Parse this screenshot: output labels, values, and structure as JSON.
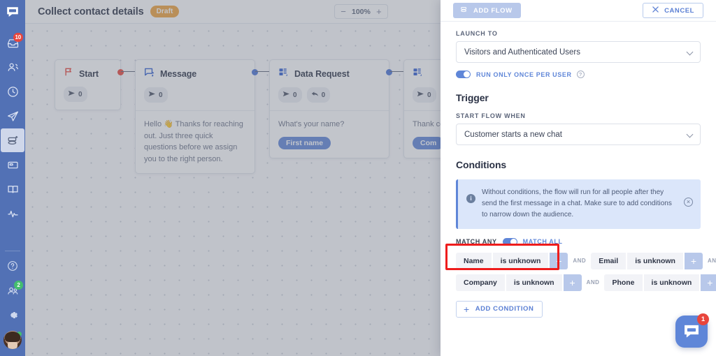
{
  "sidebar": {
    "logo_icon": "chat-logo-icon",
    "items": [
      {
        "icon": "inbox-icon",
        "name": "inbox",
        "badge": "10",
        "badge_color": "#e8453c",
        "active": false
      },
      {
        "icon": "contacts-people-icon",
        "name": "contacts",
        "badge": "",
        "active": false
      },
      {
        "icon": "clock-history-icon",
        "name": "history",
        "badge": "",
        "active": false
      },
      {
        "icon": "paper-plane-icon",
        "name": "campaigns",
        "badge": "",
        "active": false
      },
      {
        "icon": "chatbot-icon",
        "name": "chatbots",
        "badge": "",
        "active": true
      },
      {
        "icon": "card-icon",
        "name": "cards",
        "badge": "",
        "active": false
      },
      {
        "icon": "book-icon",
        "name": "knowledge-base",
        "badge": "",
        "active": false
      },
      {
        "icon": "pulse-analytics-icon",
        "name": "analytics",
        "badge": "",
        "active": false
      }
    ],
    "bottom_items": [
      {
        "icon": "help-question-icon",
        "name": "help",
        "badge": ""
      },
      {
        "icon": "team-members-icon",
        "name": "team",
        "badge": "2",
        "badge_color": "#44be6e"
      },
      {
        "icon": "gear-icon",
        "name": "settings",
        "badge": ""
      }
    ],
    "avatar_name": "user-avatar",
    "avatar_status": "online"
  },
  "header": {
    "title": "Collect contact details",
    "status_badge": "Draft",
    "status_badge_color": "#f0a33c",
    "zoom": {
      "minus": "−",
      "value": "100%",
      "plus": "+"
    }
  },
  "canvas": {
    "nodes": [
      {
        "name": "start-node",
        "icon": "flag-icon",
        "title": "Start",
        "dot_color": "red",
        "stats": [
          {
            "icon": "send-icon",
            "value": "0"
          }
        ],
        "body_text": "",
        "tag": ""
      },
      {
        "name": "message-node",
        "icon": "message-icon",
        "title": "Message",
        "dot_color": "blue",
        "stats": [
          {
            "icon": "send-icon",
            "value": "0"
          }
        ],
        "body_text": "Hello 👋 Thanks for reaching out. Just three quick questions before we assign you to the right person.",
        "tag": ""
      },
      {
        "name": "data-request-node",
        "icon": "data-request-icon",
        "title": "Data Request",
        "dot_color": "blue",
        "stats": [
          {
            "icon": "send-icon",
            "value": "0"
          },
          {
            "icon": "reply-icon",
            "value": "0"
          }
        ],
        "body_text": "What's your name?",
        "tag": "First name"
      },
      {
        "name": "data-request-node-2",
        "icon": "data-request-icon",
        "title": "",
        "dot_color": "blue",
        "stats": [
          {
            "icon": "send-icon",
            "value": "0"
          }
        ],
        "body_text": "Thank compa",
        "tag": "Com"
      }
    ]
  },
  "panel": {
    "add_flow_label": "ADD FLOW",
    "add_flow_icon": "chatbot-icon",
    "cancel_label": "CANCEL",
    "cancel_icon": "close-icon",
    "launch_to_label": "LAUNCH TO",
    "launch_to_value": "Visitors and Authenticated Users",
    "run_once_label": "RUN ONLY ONCE PER USER",
    "run_once_enabled": true,
    "help_icon": "help-question-icon",
    "trigger_title": "Trigger",
    "start_flow_label": "START FLOW WHEN",
    "start_flow_value": "Customer starts a new chat",
    "conditions_title": "Conditions",
    "info_text": "Without conditions, the flow will run for all people after they send the first message in a chat. Make sure to add conditions to narrow down the audience.",
    "info_icon": "info-icon",
    "info_close_icon": "close-circle-icon",
    "match_any_label": "MATCH ANY",
    "match_all_label": "MATCH ALL",
    "match_toggle_on": "all",
    "conditions": [
      [
        {
          "field": "Name",
          "operator": "is unknown",
          "plus": "+"
        },
        {
          "joiner": "AND"
        },
        {
          "field": "Email",
          "operator": "is unknown",
          "plus": "+"
        },
        {
          "joiner": "AND"
        }
      ],
      [
        {
          "field": "Company",
          "operator": "is unknown",
          "plus": "+"
        },
        {
          "joiner": "AND"
        },
        {
          "field": "Phone",
          "operator": "is unknown",
          "plus": "+"
        }
      ]
    ],
    "add_condition_label": "ADD CONDITION",
    "add_condition_icon": "plus-icon"
  },
  "chat_widget": {
    "icon": "chat-bubble-icon",
    "badge": "1",
    "color": "#5f86d8"
  },
  "annotation": {
    "type": "highlight-rectangle",
    "color": "#ee1c1c",
    "target": "first-condition-chip-group"
  }
}
